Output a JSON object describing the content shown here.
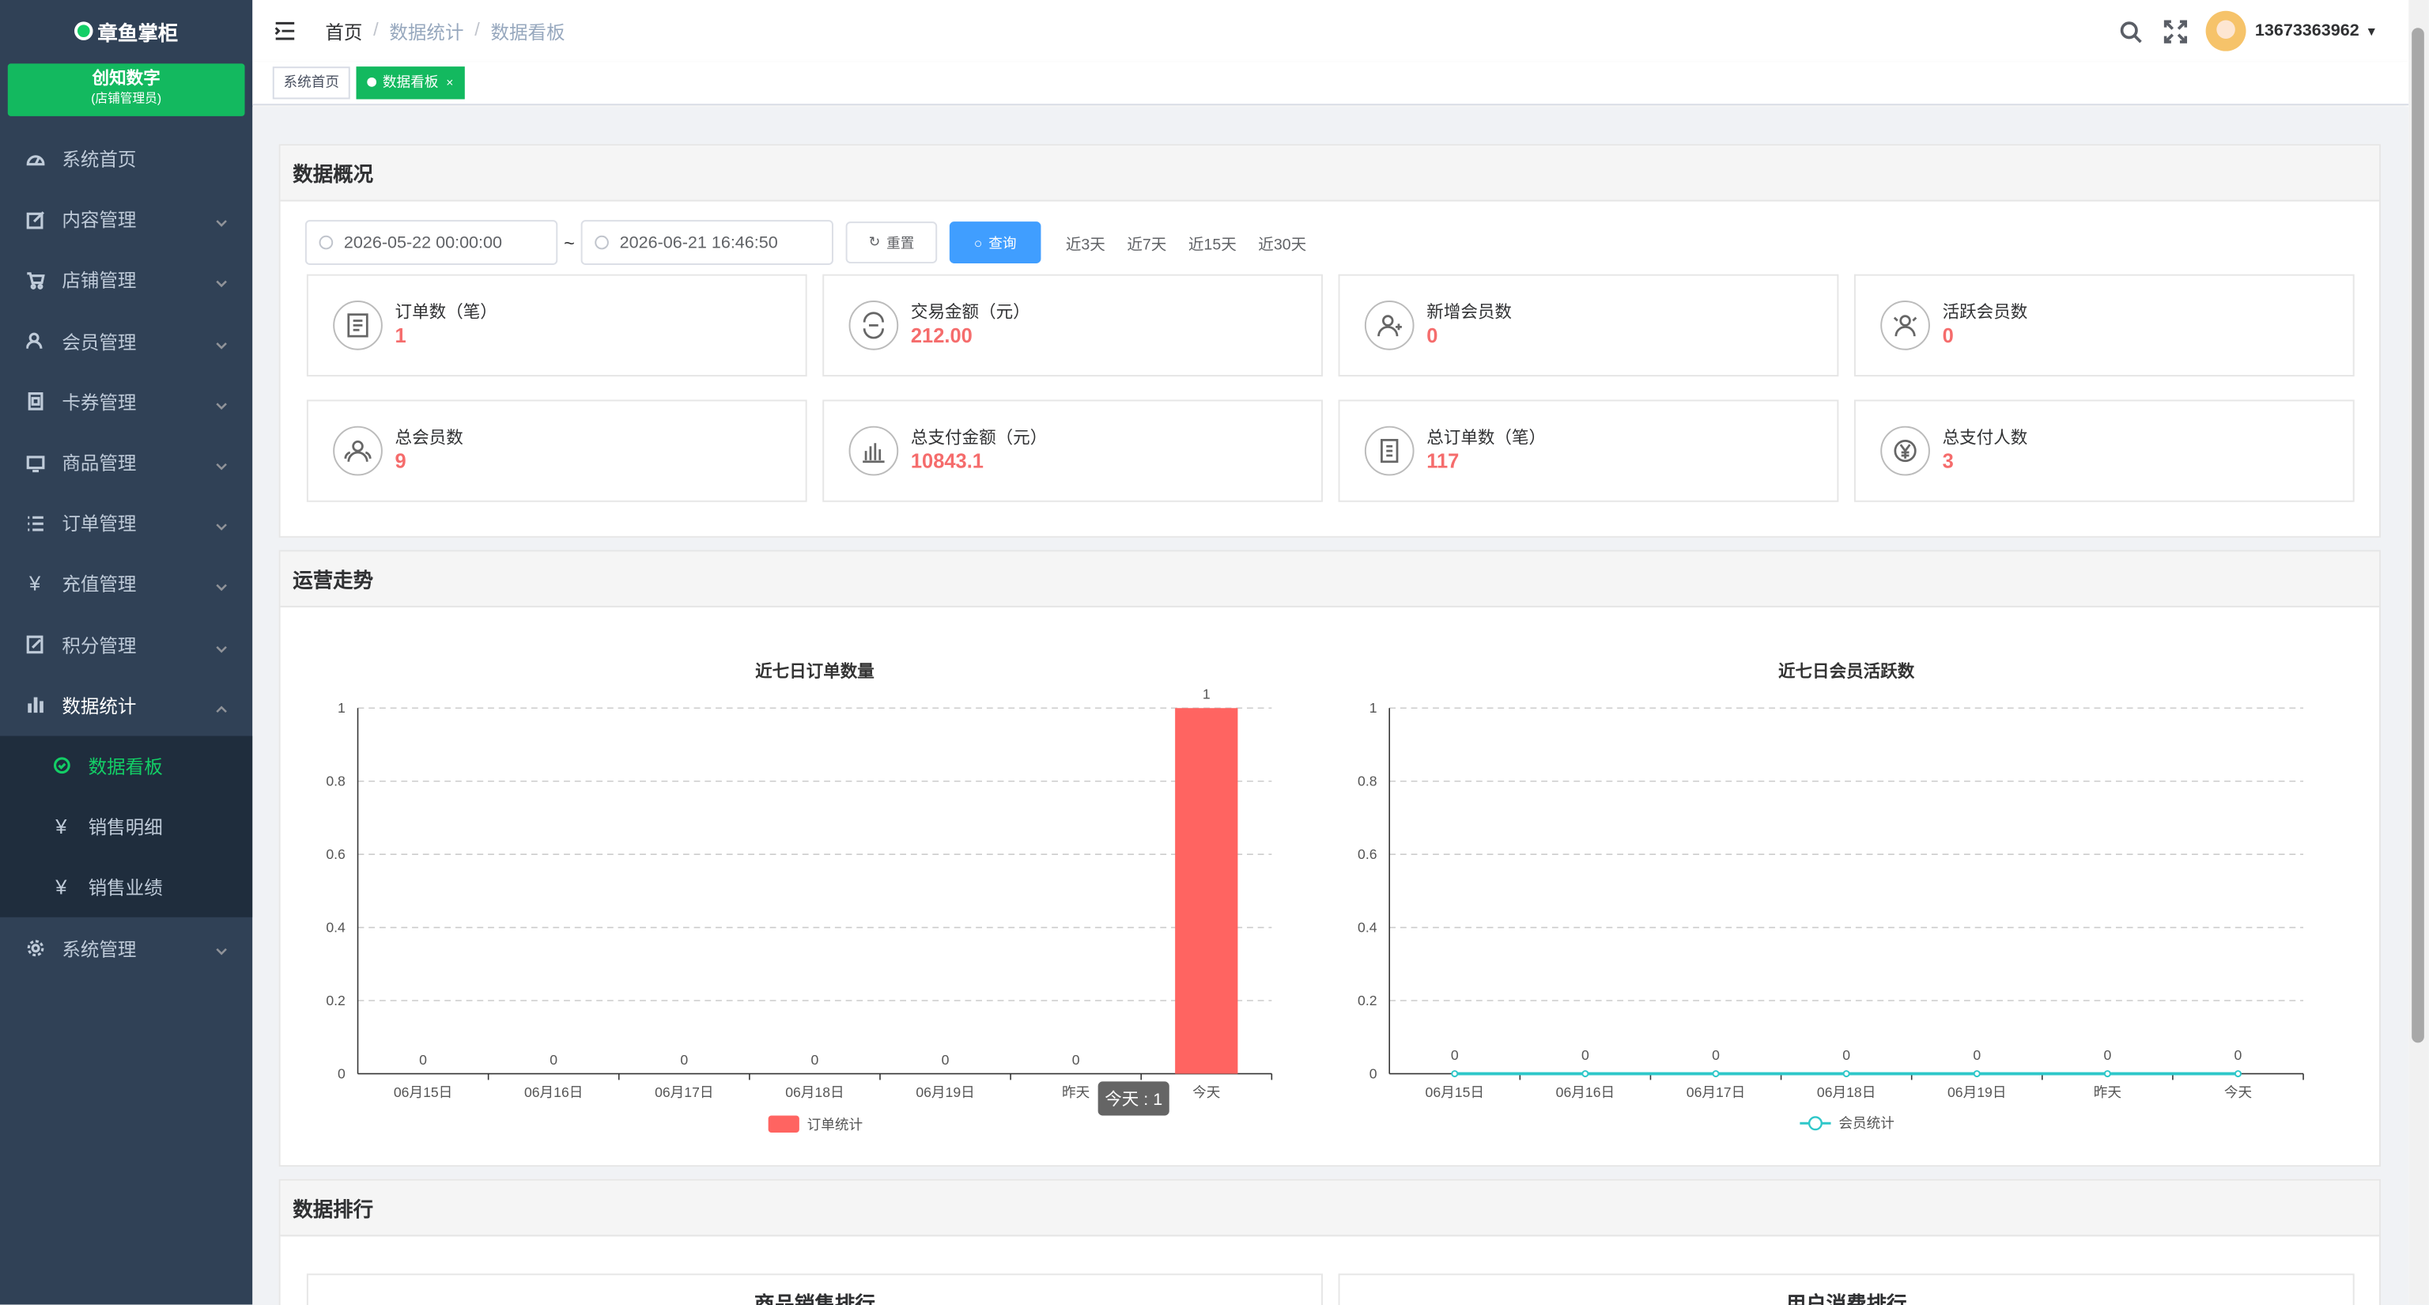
{
  "app": {
    "name": "章鱼掌柜"
  },
  "shop": {
    "name": "创知数字",
    "role": "(店铺管理员)"
  },
  "sidebar": {
    "items": [
      {
        "label": "系统首页",
        "icon": "dashboard-icon"
      },
      {
        "label": "内容管理",
        "icon": "edit-icon"
      },
      {
        "label": "店铺管理",
        "icon": "cart-icon"
      },
      {
        "label": "会员管理",
        "icon": "user-icon"
      },
      {
        "label": "卡券管理",
        "icon": "coupon-icon"
      },
      {
        "label": "商品管理",
        "icon": "goods-icon"
      },
      {
        "label": "订单管理",
        "icon": "list-icon"
      },
      {
        "label": "充值管理",
        "icon": "yen-icon"
      },
      {
        "label": "积分管理",
        "icon": "points-icon"
      },
      {
        "label": "数据统计",
        "icon": "chart-icon"
      },
      {
        "label": "系统管理",
        "icon": "gear-icon"
      }
    ],
    "sub_items": [
      {
        "label": "数据看板"
      },
      {
        "label": "销售明细"
      },
      {
        "label": "销售业绩"
      }
    ],
    "active_color": "#13ce66"
  },
  "breadcrumb": [
    "首页",
    "数据统计",
    "数据看板"
  ],
  "user": {
    "name": "13673363962"
  },
  "tags": [
    {
      "label": "系统首页"
    },
    {
      "label": "数据看板"
    }
  ],
  "overview": {
    "title": "数据概况",
    "start": "2026-05-22 00:00:00",
    "end": "2026-06-21 16:46:50",
    "tilde": "~",
    "reset_label": "重置",
    "query_label": "查询",
    "ranges": [
      "近3天",
      "近7天",
      "近15天",
      "近30天"
    ],
    "stats": [
      {
        "label": "订单数（笔）",
        "value": "1"
      },
      {
        "label": "交易金额（元）",
        "value": "212.00"
      },
      {
        "label": "新增会员数",
        "value": "0"
      },
      {
        "label": "活跃会员数",
        "value": "0"
      },
      {
        "label": "总会员数",
        "value": "9"
      },
      {
        "label": "总支付金额（元）",
        "value": "10843.1"
      },
      {
        "label": "总订单数（笔）",
        "value": "117"
      },
      {
        "label": "总支付人数",
        "value": "3"
      }
    ]
  },
  "trend": {
    "title": "运营走势"
  },
  "ranking": {
    "title": "数据排行",
    "left_title": "商品销售排行",
    "right_title": "用户消费排行"
  },
  "chart_data": [
    {
      "type": "bar",
      "title": "近七日订单数量",
      "categories": [
        "06月15日",
        "06月16日",
        "06月17日",
        "06月18日",
        "06月19日",
        "昨天",
        "今天"
      ],
      "series": [
        {
          "name": "订单统计",
          "values": [
            0,
            0,
            0,
            0,
            0,
            0,
            1
          ]
        }
      ],
      "ylim": [
        0,
        1
      ],
      "yticks": [
        "0",
        "0.2",
        "0.4",
        "0.6",
        "0.8",
        "1"
      ],
      "color": "#ff6461",
      "tooltip": "今天 : 1",
      "legend": "bottom"
    },
    {
      "type": "line",
      "title": "近七日会员活跃数",
      "categories": [
        "06月15日",
        "06月16日",
        "06月17日",
        "06月18日",
        "06月19日",
        "昨天",
        "今天"
      ],
      "series": [
        {
          "name": "会员统计",
          "values": [
            0,
            0,
            0,
            0,
            0,
            0,
            0
          ]
        }
      ],
      "ylim": [
        0,
        1
      ],
      "yticks": [
        "0",
        "0.2",
        "0.4",
        "0.6",
        "0.8",
        "1"
      ],
      "color": "#2ec7c9",
      "legend": "bottom"
    }
  ]
}
